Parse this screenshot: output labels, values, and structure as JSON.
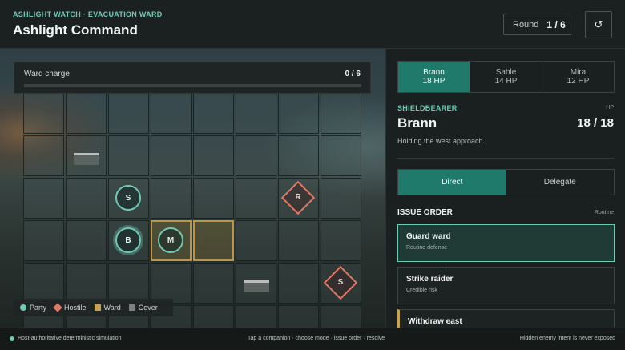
{
  "header": {
    "eyebrow": "ASHLIGHT WATCH · EVACUATION WARD",
    "title": "Ashlight Command",
    "round_label": "Round",
    "round_value": "1 / 6",
    "reset_icon": "refresh-icon"
  },
  "board": {
    "ward_charge_label": "Ward charge",
    "ward_charge_value": "0 / 6",
    "ward_charge_fraction": 0,
    "party_tokens": [
      {
        "label": "S",
        "col": 2,
        "row": 2,
        "selected": false
      },
      {
        "label": "B",
        "col": 2,
        "row": 3,
        "selected": true
      },
      {
        "label": "M",
        "col": 3,
        "row": 3,
        "selected": false
      }
    ],
    "hostile_tokens": [
      {
        "label": "R",
        "col": 6,
        "row": 2
      },
      {
        "label": "S",
        "col": 7,
        "row": 4
      }
    ],
    "ward_cells": [
      [
        3,
        3
      ],
      [
        4,
        3
      ]
    ],
    "cover_cells": [
      [
        1,
        1
      ],
      [
        5,
        4
      ]
    ],
    "legend": {
      "party": "Party",
      "hostile": "Hostile",
      "ward": "Ward",
      "cover": "Cover"
    }
  },
  "panel": {
    "companions": [
      {
        "name": "Brann",
        "hp": "18 HP",
        "active": true
      },
      {
        "name": "Sable",
        "hp": "14 HP",
        "active": false
      },
      {
        "name": "Mira",
        "hp": "12 HP",
        "active": false
      }
    ],
    "role": "SHIELDBEARER",
    "hp_label": "HP",
    "name": "Brann",
    "hp_value": "18 / 18",
    "description": "Holding the west approach.",
    "modes": {
      "direct": "Direct",
      "delegate": "Delegate"
    },
    "issue_order_title": "ISSUE ORDER",
    "issue_order_tag": "Routine",
    "orders": [
      {
        "title": "Guard ward",
        "sub": "Routine defense"
      },
      {
        "title": "Strike raider",
        "sub": "Credible risk"
      },
      {
        "title": "Withdraw east",
        "sub": ""
      }
    ]
  },
  "footer": {
    "left": "Host-authoritative deterministic simulation",
    "middle": "Tap a companion · choose mode · issue order · resolve",
    "right": "Hidden enemy intent is never exposed"
  },
  "colors": {
    "accent": "#6fc9b4",
    "active_fill": "#1f7a6b",
    "hostile": "#e07866",
    "ward": "#c8a24e",
    "cover": "#7a817f"
  }
}
